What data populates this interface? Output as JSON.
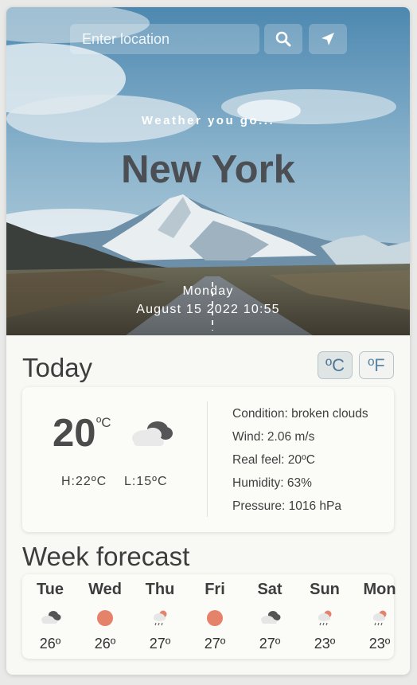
{
  "search": {
    "placeholder": "Enter location"
  },
  "header": {
    "tagline": "Weather you go...",
    "city": "New York",
    "day": "Monday",
    "date": "August 15 2022 10:55"
  },
  "today": {
    "title": "Today",
    "unit_c": "ºC",
    "unit_f": "ºF",
    "temp": "20",
    "temp_unit": "ºC",
    "high": "H:22ºC",
    "low": "L:15ºC",
    "condition": "Condition: broken clouds",
    "wind": "Wind: 2.06 m/s",
    "real_feel": "Real feel: 20ºC",
    "humidity": "Humidity: 63%",
    "pressure": "Pressure: 1016 hPa",
    "icon": "broken-clouds"
  },
  "week": {
    "title": "Week forecast",
    "days": [
      {
        "day": "Tue",
        "temp": "26º",
        "icon": "broken-clouds"
      },
      {
        "day": "Wed",
        "temp": "26º",
        "icon": "clear-sun"
      },
      {
        "day": "Thu",
        "temp": "27º",
        "icon": "rain"
      },
      {
        "day": "Fri",
        "temp": "27º",
        "icon": "clear-sun"
      },
      {
        "day": "Sat",
        "temp": "27º",
        "icon": "broken-clouds"
      },
      {
        "day": "Sun",
        "temp": "23º",
        "icon": "rain"
      },
      {
        "day": "Mon",
        "temp": "23º",
        "icon": "rain"
      }
    ]
  },
  "colors": {
    "sun": "#e5826a",
    "accent": "#5c87a6"
  }
}
